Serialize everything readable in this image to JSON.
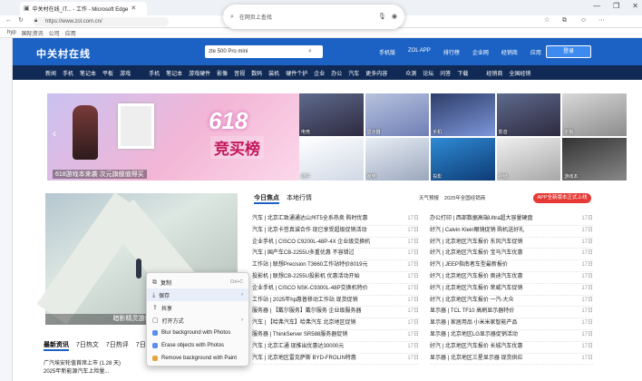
{
  "browser": {
    "tab_title": "中关村在线_IT... - 工作 - Microsoft Edge",
    "url": "https://www.zol.com.cn/",
    "bookmarks": [
      "hyp",
      "国际资讯",
      "公司",
      "应用"
    ],
    "float_search_placeholder": "在网页上查找",
    "window_controls": [
      "—",
      "❐",
      "✕"
    ]
  },
  "header": {
    "logo": "中关村在线",
    "search_value": "zte 500 Pro mini",
    "top_links": [
      "手机版",
      "ZOL APP",
      "排行榜",
      "企业网",
      "经销商",
      "应用"
    ],
    "post_button": "登录"
  },
  "nav": [
    "新闻",
    "手机",
    "笔记本",
    "平板",
    "游戏",
    "手机",
    "笔记本",
    "游戏硬件",
    "影像",
    "音视",
    "数码",
    "装机",
    "硬件个护",
    "企业",
    "办公",
    "汽车",
    "更多内容",
    "众测",
    "论坛",
    "问答",
    "下载",
    "经销商",
    "全国经销"
  ],
  "banner": {
    "big": "618",
    "title": "竞买榜",
    "caption": "618游戏本来袭 次元旗舰值得买",
    "tiles": [
      "电竞",
      "显示器",
      "手机",
      "影音",
      "平板",
      "硬件",
      "家电",
      "投影",
      "存储",
      "游戏本"
    ]
  },
  "feature": {
    "caption": "暗影精灵游戏本新品"
  },
  "low_tabs": [
    "最新资讯",
    "7日热文",
    "7日热评",
    "7日热门"
  ],
  "low_rows": [
    "广汽埃安轮值首席上市 (1.28 天)",
    "2025年新能源汽车上险量..."
  ],
  "hot": {
    "tabs": [
      "今日焦点",
      "本地行情"
    ],
    "bar": [
      "天气预报",
      "2025年全国经销商"
    ],
    "red_button": "APP全新版本正式上线"
  },
  "news_left": [
    {
      "t": "汽车 | 北京汇致通通达山州T5全系热卖 购时优惠",
      "d": "17日"
    },
    {
      "t": "汽车 | 北京卡签真诚合作 现已享受超级促销活动",
      "d": "17日"
    },
    {
      "t": "企业手机 | CISCO C9200L-48P-4X 企业级交换机",
      "d": "17日"
    },
    {
      "t": "汽车 | 国产车CB-2255U多重优惠 不容错过",
      "d": "17日"
    },
    {
      "t": "工作站 | 联想Precision T3660工作站特价8019元",
      "d": "17日"
    },
    {
      "t": "投影机 | 联想CB-2255U投影机 优惠活动开始",
      "d": "17日"
    },
    {
      "t": "企业手机 | CISCO NSK-C9300L-48P交换机特价",
      "d": "17日"
    },
    {
      "t": "工作站 | 2025年hp惠普移动工作站 现货促销",
      "d": "17日"
    },
    {
      "t": "服务器 | 【戴尔服务】戴尔服务 企业级服务器",
      "d": "17日"
    },
    {
      "t": "汽车 | 【哈弗汽车】哈弗汽车 北京地区促销",
      "d": "17日"
    },
    {
      "t": "服务器 | ThinkServer SR588服务器促销",
      "d": "17日"
    },
    {
      "t": "汽车 | 北京汇通 现推出优惠达30000元",
      "d": "17日"
    },
    {
      "t": "汽车 | 北京地区雷克萨斯 BYD-FROLIN特惠",
      "d": "17日"
    }
  ],
  "news_right": [
    {
      "t": "办公打印 | 西部数据高端Ultra超大容量硬盘",
      "d": "17日"
    },
    {
      "t": "好汽 | Calvin Klein眼镜促销 购机送好礼",
      "d": "17日"
    },
    {
      "t": "好汽 | 北京地区汽车报价 东风汽车促销",
      "d": "17日"
    },
    {
      "t": "好汽 | 北京地区汽车报价 宝马汽车优惠",
      "d": "17日"
    },
    {
      "t": "好汽 | JEEP指南者车型最新报价",
      "d": "17日"
    },
    {
      "t": "好汽 | 北京地区汽车报价 奥迪汽车优惠",
      "d": "17日"
    },
    {
      "t": "好汽 | 北京地区汽车报价 荣威汽车促销",
      "d": "17日"
    },
    {
      "t": "好汽 | 北京地区汽车报价 一汽-大众",
      "d": "17日"
    },
    {
      "t": "显示器 | TCL TF10 高刷显示器特价",
      "d": "17日"
    },
    {
      "t": "显示器 | 家居用品 小米米家智能产品",
      "d": "17日"
    },
    {
      "t": "显示器 | 北京地区LG显示器促销活动",
      "d": "17日"
    },
    {
      "t": "好汽 | 北京地区汽车报价 长城汽车优惠",
      "d": "17日"
    },
    {
      "t": "显示器 | 北京地区三星显示器 现货供应",
      "d": "17日"
    }
  ],
  "context_menu": {
    "items": [
      {
        "label": "复制",
        "key": "Ctrl+C"
      },
      {
        "label": "保存",
        "key": ""
      },
      {
        "label": "共享",
        "key": ""
      },
      {
        "label": "打开方式",
        "key": ""
      },
      {
        "label": "Blur background with Photos",
        "key": ""
      },
      {
        "label": "Erase objects with Photos",
        "key": ""
      },
      {
        "label": "Remove background with Paint",
        "key": ""
      }
    ]
  }
}
